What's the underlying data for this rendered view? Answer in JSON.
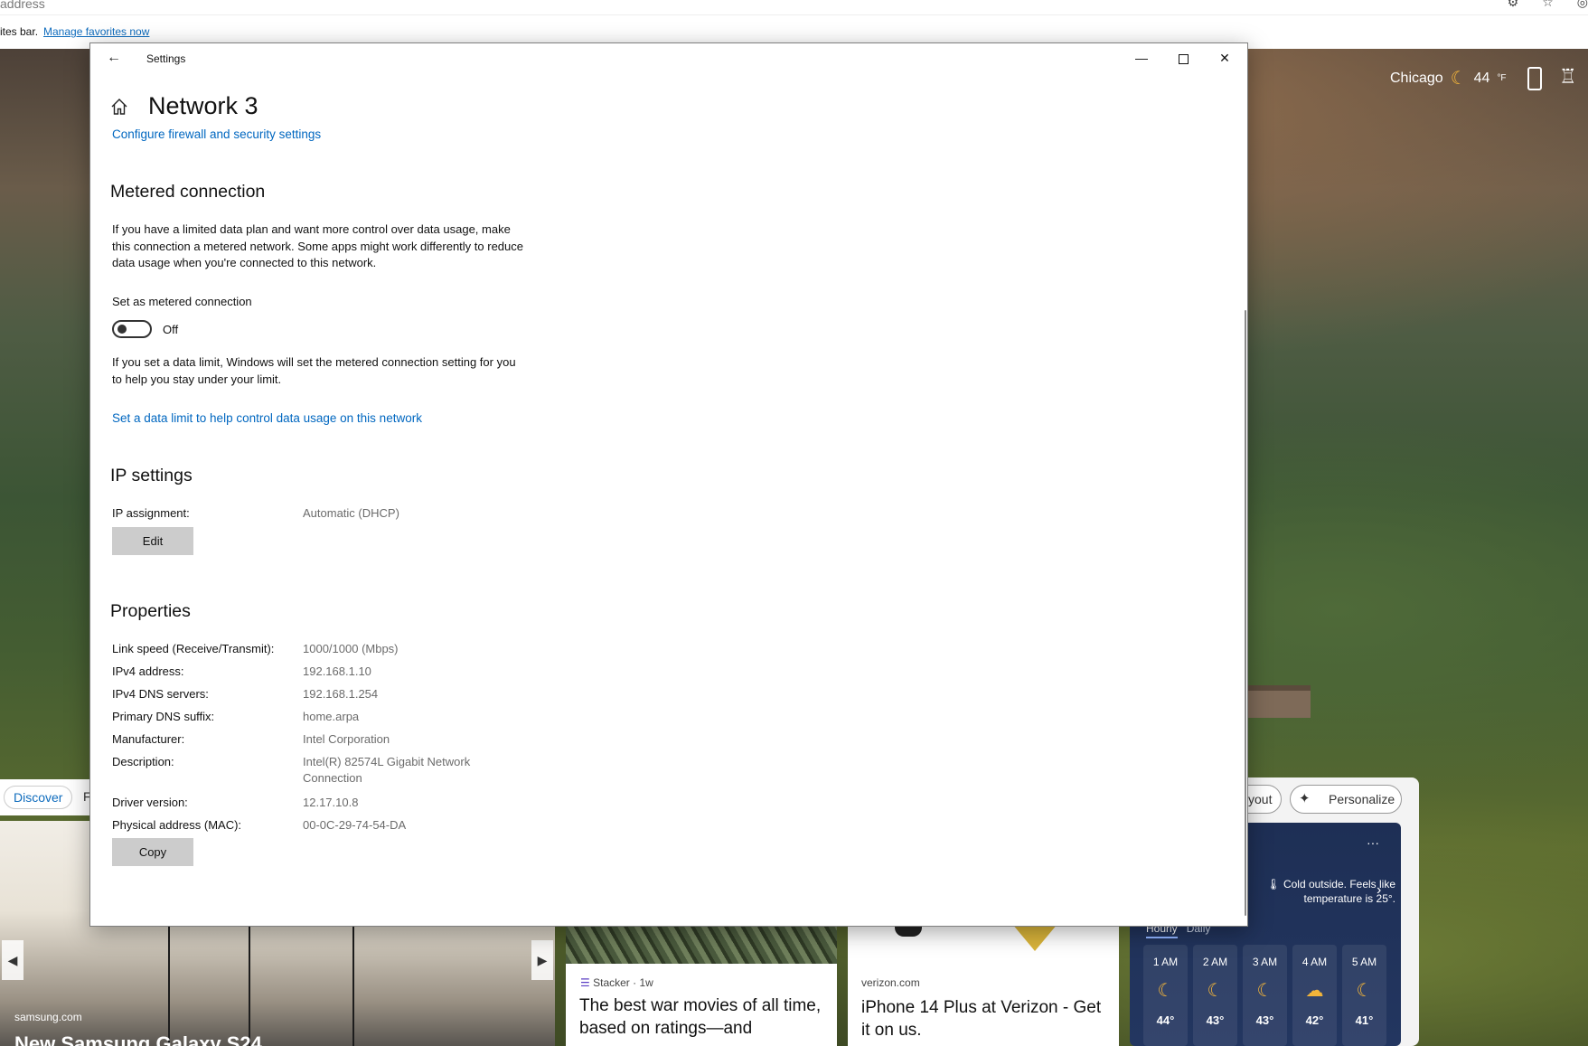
{
  "browser": {
    "address_text": "address",
    "favorites_bar_text": "ites bar.",
    "manage_favorites_link": "Manage favorites now"
  },
  "newtab": {
    "weather_top": {
      "city": "Chicago",
      "temp": "44",
      "unit": "°F"
    },
    "feed_tabs": [
      "Discover",
      "F"
    ],
    "layout_label": "yout",
    "personalize_label": "Personalize",
    "cards": [
      {
        "source": "samsung.com",
        "title": "New Samsung Galaxy S24"
      },
      {
        "source": "Stacker",
        "age": "· 1w",
        "title": "The best war movies of all time, based on ratings—and"
      },
      {
        "source": "verizon.com",
        "title": "iPhone 14 Plus at Verizon - Get it on us."
      }
    ],
    "weather_card": {
      "more": "···",
      "tip": "Cold outside. Feels like temperature is 25°.",
      "tabs": [
        "Hourly",
        "Daily"
      ],
      "hours": [
        {
          "time": "1 AM",
          "icon": "moon-icon",
          "temp": "44°"
        },
        {
          "time": "2 AM",
          "icon": "moon-icon",
          "temp": "43°"
        },
        {
          "time": "3 AM",
          "icon": "moon-icon",
          "temp": "43°"
        },
        {
          "time": "4 AM",
          "icon": "moon-cloud-icon",
          "temp": "42°"
        },
        {
          "time": "5 AM",
          "icon": "moon-icon",
          "temp": "41°"
        }
      ]
    }
  },
  "settings": {
    "window_title": "Settings",
    "page_title": "Network 3",
    "firewall_link": "Configure firewall and security settings",
    "metered": {
      "heading": "Metered connection",
      "description": "If you have a limited data plan and want more control over data usage, make this connection a metered network. Some apps might work differently to reduce data usage when you're connected to this network.",
      "toggle_label": "Set as metered connection",
      "toggle_state": "Off",
      "data_limit_description": "If you set a data limit, Windows will set the metered connection setting for you to help you stay under your limit.",
      "data_limit_link": "Set a data limit to help control data usage on this network"
    },
    "ip_settings": {
      "heading": "IP settings",
      "assignment_label": "IP assignment:",
      "assignment_value": "Automatic (DHCP)",
      "edit_button": "Edit"
    },
    "properties": {
      "heading": "Properties",
      "rows": [
        {
          "label": "Link speed (Receive/Transmit):",
          "value": "1000/1000 (Mbps)"
        },
        {
          "label": "IPv4 address:",
          "value": "192.168.1.10"
        },
        {
          "label": "IPv4 DNS servers:",
          "value": "192.168.1.254"
        },
        {
          "label": "Primary DNS suffix:",
          "value": "home.arpa"
        },
        {
          "label": "Manufacturer:",
          "value": "Intel Corporation"
        },
        {
          "label": "Description:",
          "value": "Intel(R) 82574L Gigabit Network Connection"
        },
        {
          "label": "Driver version:",
          "value": "12.17.10.8"
        },
        {
          "label": "Physical address (MAC):",
          "value": "00-0C-29-74-54-DA"
        }
      ],
      "copy_button": "Copy"
    }
  },
  "colors": {
    "link": "#0067c0",
    "button_gray": "#cccccc",
    "value_gray": "#6b6b6b"
  }
}
